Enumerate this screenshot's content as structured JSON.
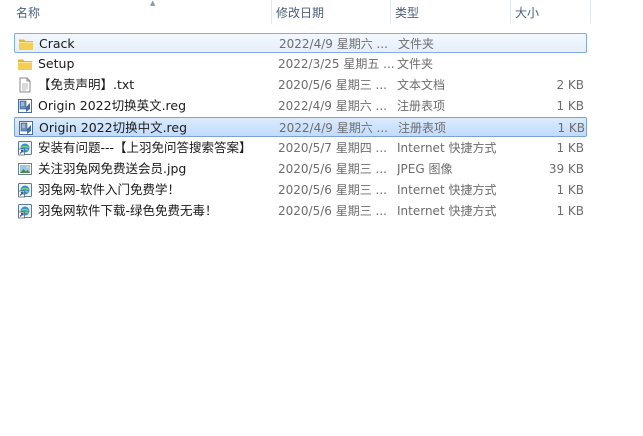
{
  "columns": {
    "name": "名称",
    "date": "修改日期",
    "type": "类型",
    "size": "大小"
  },
  "files": [
    {
      "name": "Crack",
      "date": "2022/4/9 星期六 ...",
      "type": "文件夹",
      "size": "",
      "icon": "folder-icon"
    },
    {
      "name": "Setup",
      "date": "2022/3/25 星期五 ...",
      "type": "文件夹",
      "size": "",
      "icon": "folder-icon"
    },
    {
      "name": "【免责声明】.txt",
      "date": "2020/5/6 星期三 ...",
      "type": "文本文档",
      "size": "2 KB",
      "icon": "text-file-icon"
    },
    {
      "name": "Origin 2022切换英文.reg",
      "date": "2022/4/9 星期六 ...",
      "type": "注册表项",
      "size": "1 KB",
      "icon": "registry-file-icon"
    },
    {
      "name": "Origin 2022切换中文.reg",
      "date": "2022/4/9 星期六 ...",
      "type": "注册表项",
      "size": "1 KB",
      "icon": "registry-file-icon"
    },
    {
      "name": "安装有问题---【上羽免问答搜索答案】",
      "date": "2020/5/7 星期四 ...",
      "type": "Internet 快捷方式",
      "size": "1 KB",
      "icon": "internet-shortcut-icon"
    },
    {
      "name": "关注羽兔网免费送会员.jpg",
      "date": "2020/5/6 星期三 ...",
      "type": "JPEG 图像",
      "size": "39 KB",
      "icon": "image-file-icon"
    },
    {
      "name": "羽兔网-软件入门免费学！",
      "date": "2020/5/6 星期三 ...",
      "type": "Internet 快捷方式",
      "size": "1 KB",
      "icon": "internet-shortcut-icon"
    },
    {
      "name": "羽兔网软件下载-绿色免费无毒！",
      "date": "2020/5/6 星期三 ...",
      "type": "Internet 快捷方式",
      "size": "1 KB",
      "icon": "internet-shortcut-icon"
    }
  ],
  "colors": {
    "selection_border": "#84acdd",
    "header_text": "#4c607a",
    "detail_text": "#6d6d6d"
  }
}
